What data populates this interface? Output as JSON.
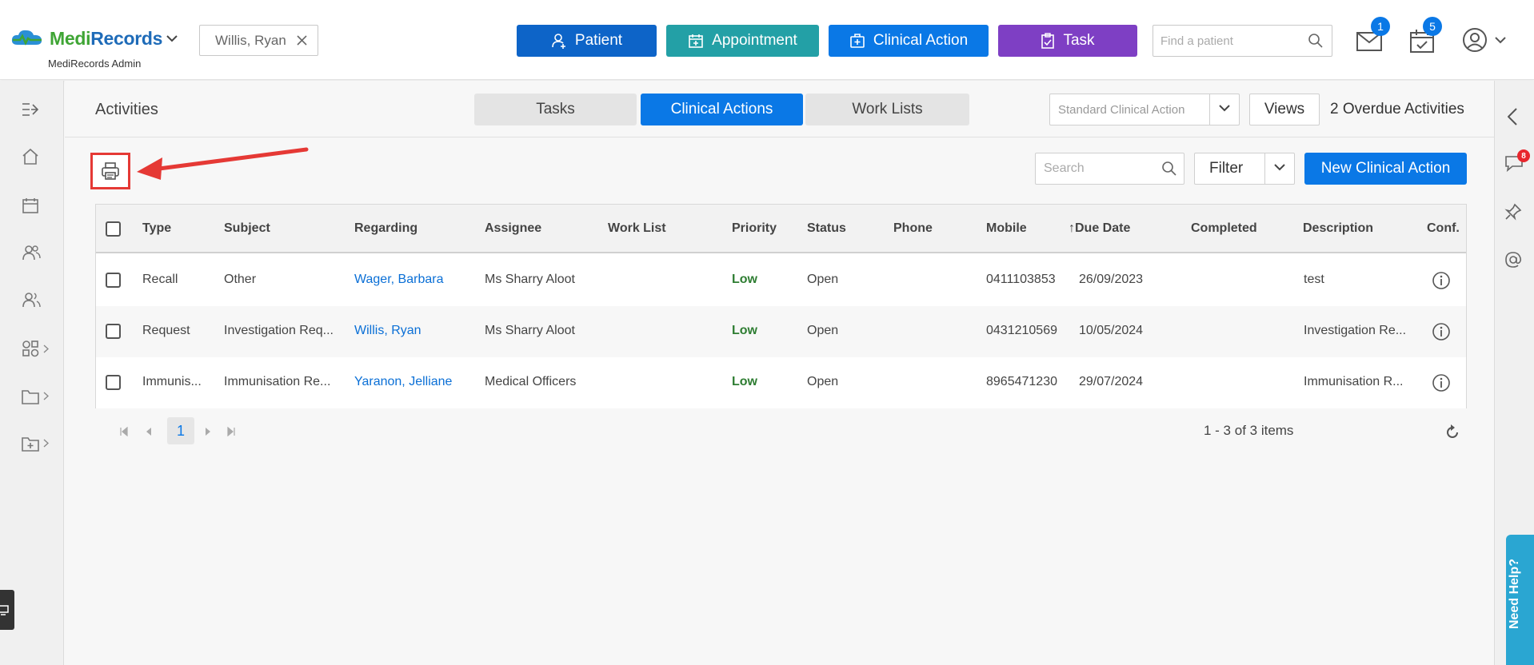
{
  "header": {
    "brand_medi": "Medi",
    "brand_records": "Records",
    "brand_sub": "MediRecords Admin",
    "patient_chip": "Willis, Ryan",
    "buttons": {
      "patient": "Patient",
      "appointment": "Appointment",
      "clinical_action": "Clinical Action",
      "task": "Task"
    },
    "find_placeholder": "Find a patient",
    "mail_badge": "1",
    "calendar_badge": "5"
  },
  "activities": {
    "title": "Activities",
    "tabs": [
      "Tasks",
      "Clinical Actions",
      "Work Lists"
    ],
    "active_tab": "Clinical Actions",
    "select_value": "Standard Clinical Action",
    "views_label": "Views",
    "overdue": "2 Overdue Activities"
  },
  "toolbar": {
    "search_placeholder": "Search",
    "filter_label": "Filter",
    "new_button": "New Clinical Action"
  },
  "grid": {
    "columns": [
      "Type",
      "Subject",
      "Regarding",
      "Assignee",
      "Work List",
      "Priority",
      "Status",
      "Phone",
      "Mobile",
      "Due Date",
      "Completed",
      "Description",
      "Conf."
    ],
    "sort_indicator": "↑",
    "rows": [
      {
        "type": "Recall",
        "subject": "Other",
        "regarding": "Wager, Barbara",
        "assignee": "Ms Sharry Aloot",
        "work_list": "",
        "priority": "Low",
        "status": "Open",
        "phone": "",
        "mobile": "0411103853",
        "due": "26/09/2023",
        "completed": "",
        "description": "test"
      },
      {
        "type": "Request",
        "subject": "Investigation Req...",
        "regarding": "Willis, Ryan",
        "assignee": "Ms Sharry Aloot",
        "work_list": "",
        "priority": "Low",
        "status": "Open",
        "phone": "",
        "mobile": "0431210569",
        "due": "10/05/2024",
        "completed": "",
        "description": "Investigation Re..."
      },
      {
        "type": "Immunis...",
        "subject": "Immunisation Re...",
        "regarding": "Yaranon, Jelliane",
        "assignee": "Medical Officers",
        "work_list": "",
        "priority": "Low",
        "status": "Open",
        "phone": "",
        "mobile": "8965471230",
        "due": "29/07/2024",
        "completed": "",
        "description": "Immunisation R..."
      }
    ]
  },
  "pager": {
    "current_page": "1",
    "info": "1 - 3 of 3 items"
  },
  "right": {
    "chat_badge": "8",
    "help_label": "Need Help?"
  },
  "colors": {
    "primary": "#0a78e6",
    "patient_btn": "#0d64c8",
    "appointment_btn": "#23a0a6",
    "task_btn": "#7e3fc4",
    "highlight": "#e53935"
  }
}
